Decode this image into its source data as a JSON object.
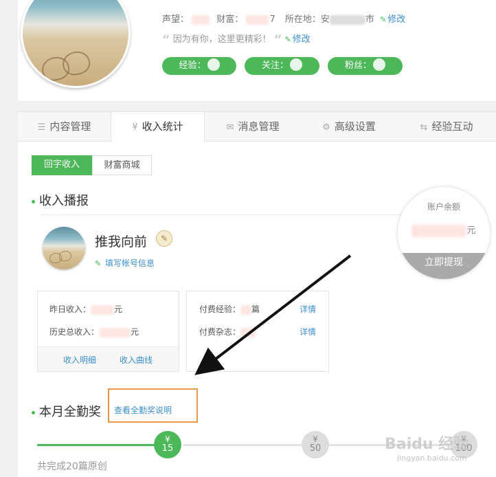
{
  "profile": {
    "reputation_label": "声望：",
    "wealth_label": "财富：",
    "wealth_suffix": "7",
    "location_label": "所在地：",
    "location_prefix": "安",
    "location_suffix": "市",
    "edit_label": "修改",
    "motto": "因为有你，这里更精彩！",
    "experience_label": "经验：",
    "follow_label": "关注：",
    "fans_label": "粉丝："
  },
  "tabs": [
    {
      "label": "内容管理",
      "icon": "list-icon"
    },
    {
      "label": "收入统计",
      "icon": "yen-icon",
      "active": true
    },
    {
      "label": "消息管理",
      "icon": "mail-icon"
    },
    {
      "label": "高级设置",
      "icon": "gear-icon"
    },
    {
      "label": "经验互动",
      "icon": "swap-icon"
    }
  ],
  "subtabs": {
    "active": "回字收入",
    "other": "财富商城"
  },
  "income": {
    "section_title": "收入播报",
    "username": "推我向前",
    "fill_account_info": "填写帐号信息",
    "yesterday_label": "昨日收入：",
    "yesterday_suffix": "元",
    "total_label": "历史总收入：",
    "total_suffix": "元",
    "income_detail": "收入明细",
    "income_curve": "收入曲线",
    "paid_exp_label": "付费经验：",
    "paid_exp_suffix": "篇",
    "paid_mag_label": "付费杂志：",
    "detail_label": "详情"
  },
  "balance": {
    "label": "账户余额",
    "suffix": "元",
    "withdraw": "立即提现"
  },
  "award": {
    "section_title": "本月全勤奖",
    "link": "查看全勤奖说明",
    "currency": "¥",
    "milestones": [
      15,
      50,
      100
    ],
    "completed_text": "共完成20篇原创"
  },
  "watermark": {
    "text": "Baidu 经验",
    "url": "jingyan.baidu.com"
  },
  "colors": {
    "accent": "#4cb85a",
    "link": "#3c8fcf",
    "highlight_box": "#e4994b"
  }
}
